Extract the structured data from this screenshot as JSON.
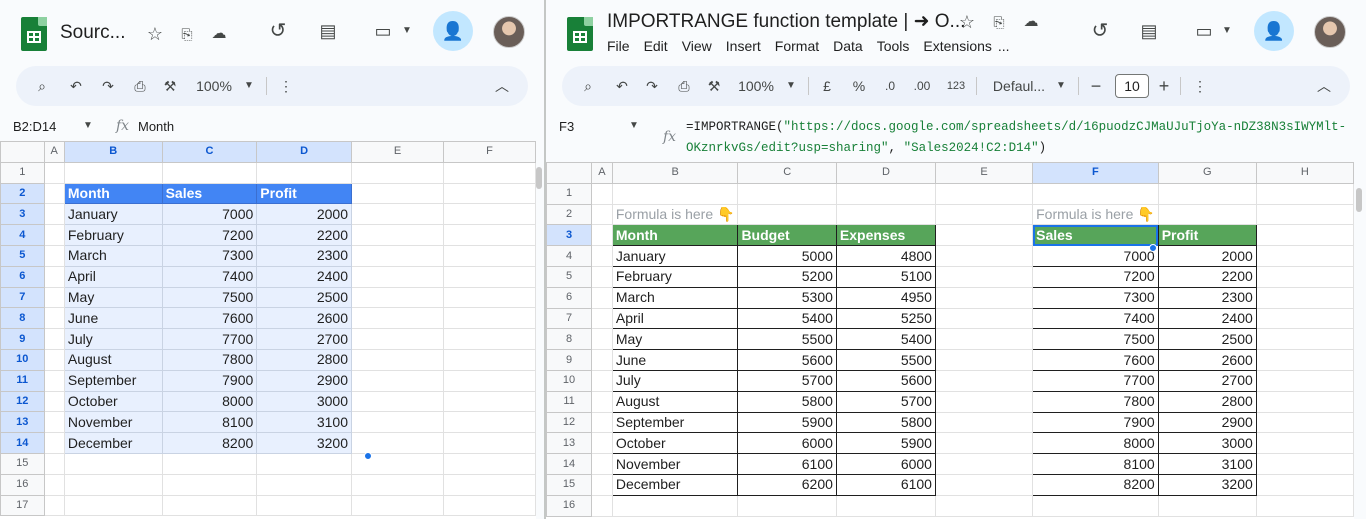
{
  "left": {
    "title": "Sourc...",
    "toolbar": {
      "zoom": "100%"
    },
    "name_box": "B2:D14",
    "formula_value": "Month",
    "col_headers": [
      "A",
      "B",
      "C",
      "D",
      "E",
      "F"
    ],
    "table_header": [
      "Month",
      "Sales",
      "Profit"
    ],
    "rows": [
      [
        "January",
        "7000",
        "2000"
      ],
      [
        "February",
        "7200",
        "2200"
      ],
      [
        "March",
        "7300",
        "2300"
      ],
      [
        "April",
        "7400",
        "2400"
      ],
      [
        "May",
        "7500",
        "2500"
      ],
      [
        "June",
        "7600",
        "2600"
      ],
      [
        "July",
        "7700",
        "2700"
      ],
      [
        "August",
        "7800",
        "2800"
      ],
      [
        "September",
        "7900",
        "2900"
      ],
      [
        "October",
        "8000",
        "3000"
      ],
      [
        "November",
        "8100",
        "3100"
      ],
      [
        "December",
        "8200",
        "3200"
      ]
    ],
    "row_numbers": [
      "1",
      "2",
      "3",
      "4",
      "5",
      "6",
      "7",
      "8",
      "9",
      "10",
      "11",
      "12",
      "13",
      "14",
      "15",
      "16",
      "17"
    ]
  },
  "right": {
    "title": "IMPORTRANGE function template | ➜ O...",
    "menus": [
      "File",
      "Edit",
      "View",
      "Insert",
      "Format",
      "Data",
      "Tools",
      "Extensions",
      "..."
    ],
    "toolbar": {
      "zoom": "100%",
      "currency": "£",
      "percent": "%",
      "dec_less": ".0",
      "dec_more": ".00",
      "num_format": "123",
      "font": "Defaul...",
      "font_size": "10"
    },
    "name_box": "F3",
    "formula_line1_a": "=IMPORTRANGE(",
    "formula_line1_b": "\"https://docs.google.com/spreadsheets/d/16puodzCJMaUJuTjoYa-nDZ38N3sIWYMlt-",
    "formula_line2_a": "OKznrkvGs/edit?usp=sharing\"",
    "formula_line2_b": ", ",
    "formula_line2_c": "\"Sales2024!C2:D14\"",
    "formula_line2_d": ")",
    "col_headers": [
      "A",
      "B",
      "C",
      "D",
      "E",
      "F",
      "G",
      "H"
    ],
    "hint": "Formula is here 👇",
    "table_header": [
      "Month",
      "Budget",
      "Expenses"
    ],
    "rows": [
      [
        "January",
        "5000",
        "4800"
      ],
      [
        "February",
        "5200",
        "5100"
      ],
      [
        "March",
        "5300",
        "4950"
      ],
      [
        "April",
        "5400",
        "5250"
      ],
      [
        "May",
        "5500",
        "5400"
      ],
      [
        "June",
        "5600",
        "5500"
      ],
      [
        "July",
        "5700",
        "5600"
      ],
      [
        "August",
        "5800",
        "5700"
      ],
      [
        "September",
        "5900",
        "5800"
      ],
      [
        "October",
        "6000",
        "5900"
      ],
      [
        "November",
        "6100",
        "6000"
      ],
      [
        "December",
        "6200",
        "6100"
      ]
    ],
    "import_header": [
      "Sales",
      "Profit"
    ],
    "import_rows": [
      [
        "7000",
        "2000"
      ],
      [
        "7200",
        "2200"
      ],
      [
        "7300",
        "2300"
      ],
      [
        "7400",
        "2400"
      ],
      [
        "7500",
        "2500"
      ],
      [
        "7600",
        "2600"
      ],
      [
        "7700",
        "2700"
      ],
      [
        "7800",
        "2800"
      ],
      [
        "7900",
        "2900"
      ],
      [
        "8000",
        "3000"
      ],
      [
        "8100",
        "3100"
      ],
      [
        "8200",
        "3200"
      ]
    ],
    "row_numbers": [
      "1",
      "2",
      "3",
      "4",
      "5",
      "6",
      "7",
      "8",
      "9",
      "10",
      "11",
      "12",
      "13",
      "14",
      "15",
      "16"
    ]
  },
  "icons": [
    "star-icon",
    "move-icon",
    "cloud-icon",
    "history-icon",
    "comment-icon",
    "video-icon",
    "share-icon",
    "search-icon",
    "undo-icon",
    "redo-icon",
    "print-icon",
    "paint-format-icon",
    "more-icon",
    "collapse-icon"
  ]
}
